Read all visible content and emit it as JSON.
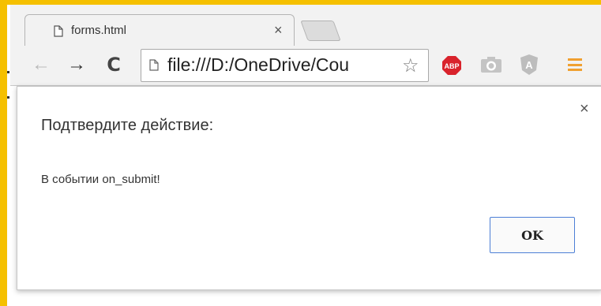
{
  "browser": {
    "tab": {
      "title": "forms.html",
      "close_symbol": "×",
      "icon": "document-icon"
    },
    "toolbar": {
      "back_symbol": "←",
      "forward_symbol": "→",
      "reload_symbol": "C",
      "url": "file:///D:/OneDrive/Cou",
      "bookmark_symbol": "☆",
      "extensions": [
        {
          "name": "adblock-plus-icon",
          "label": "ABP",
          "color": "#d9232c"
        },
        {
          "name": "camera-icon",
          "color": "#b8b8b8"
        },
        {
          "name": "angular-icon",
          "label": "A",
          "color": "#b8b8b8"
        }
      ],
      "menu_color": "#f0a030"
    }
  },
  "dialog": {
    "title": "Подтвердите действие:",
    "message": "В событии on_submit!",
    "ok_label": "OK",
    "close_symbol": "×"
  },
  "colors": {
    "frame": "#f5c000",
    "ok_border": "#4c7fd6"
  }
}
